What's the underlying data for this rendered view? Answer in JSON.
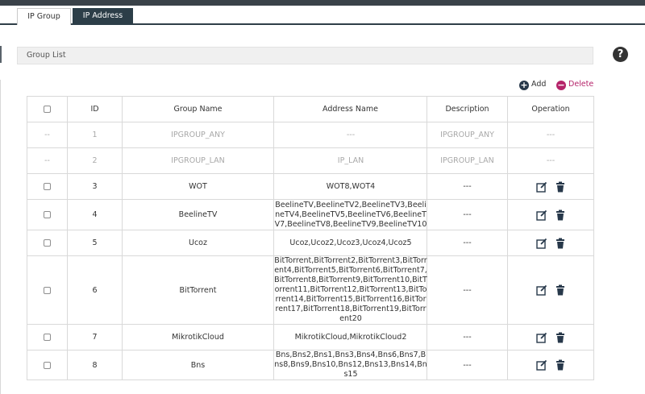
{
  "tabs": [
    {
      "label": "IP Group",
      "active": true
    },
    {
      "label": "IP Address",
      "active": false
    }
  ],
  "section": {
    "title": "Group List"
  },
  "actions": {
    "add_label": "Add",
    "delete_label": "Delete"
  },
  "colors": {
    "tab_active_bg": "#ffffff",
    "tab_inactive_bg": "#2c3e48",
    "delete_accent": "#b5246a",
    "add_icon": "#27384a"
  },
  "icons": {
    "help": "help-icon",
    "add": "plus-circle-icon",
    "delete": "minus-circle-icon",
    "edit": "edit-icon",
    "trash": "trash-icon"
  },
  "table": {
    "headers": [
      "ID",
      "Group Name",
      "Address Name",
      "Description",
      "Operation"
    ],
    "rows": [
      {
        "check": "--",
        "id": "1",
        "name": "IPGROUP_ANY",
        "address": "---",
        "description": "IPGROUP_ANY",
        "operation": "---"
      },
      {
        "check": "--",
        "id": "2",
        "name": "IPGROUP_LAN",
        "address": "IP_LAN",
        "description": "IPGROUP_LAN",
        "operation": "---"
      },
      {
        "id": "3",
        "name": "WOT",
        "address": "WOT8,WOT4",
        "description": "---"
      },
      {
        "id": "4",
        "name": "BeelineTV",
        "address": "BeelineTV,BeelineTV2,BeelineTV3,BeelineTV4,BeelineTV5,BeelineTV6,BeelineTV7,BeelineTV8,BeelineTV9,BeelineTV10",
        "description": "---"
      },
      {
        "id": "5",
        "name": "Ucoz",
        "address": "Ucoz,Ucoz2,Ucoz3,Ucoz4,Ucoz5",
        "description": "---"
      },
      {
        "id": "6",
        "name": "BitTorrent",
        "address": "BitTorrent,BitTorrent2,BitTorrent3,BitTorrent4,BitTorrent5,BitTorrent6,BitTorrent7,BitTorrent8,BitTorrent9,BitTorrent10,BitTorrent11,BitTorrent12,BitTorrent13,BitTorrent14,BitTorrent15,BitTorrent16,BitTorrent17,BitTorrent18,BitTorrent19,BitTorrent20",
        "description": "---"
      },
      {
        "id": "7",
        "name": "MikrotikCloud",
        "address": "MikrotikCloud,MikrotikCloud2",
        "description": "---"
      },
      {
        "id": "8",
        "name": "Bns",
        "address": "Bns,Bns2,Bns1,Bns3,Bns4,Bns6,Bns7,Bns8,Bns9,Bns10,Bns12,Bns13,Bns14,Bns15",
        "description": "---"
      }
    ]
  }
}
